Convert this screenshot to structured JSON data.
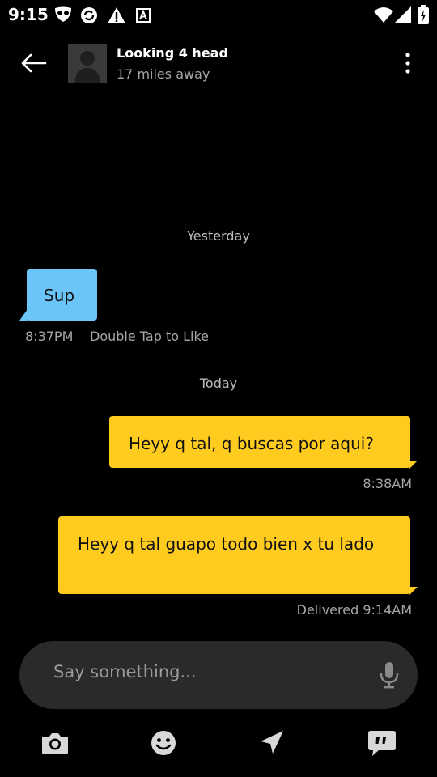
{
  "status_bar": {
    "time": "9:15",
    "icons": [
      "grindr-mask-icon",
      "sync-icon",
      "warning-icon",
      "font-a-icon",
      "wifi-icon",
      "signal-icon",
      "battery-icon"
    ]
  },
  "header": {
    "back_icon": "arrow-left-icon",
    "profile_name": "Looking 4 head",
    "distance": "17 miles away",
    "menu_icon": "more-vert-icon"
  },
  "conversation": {
    "sections": [
      {
        "day": "Yesterday",
        "messages": [
          {
            "direction": "incoming",
            "text": "Sup",
            "time": "8:37PM",
            "hint": "Double Tap to Like"
          }
        ]
      },
      {
        "day": "Today",
        "messages": [
          {
            "direction": "outgoing",
            "text": "Heyy q tal, q buscas por aqui?",
            "status": "8:38AM"
          },
          {
            "direction": "outgoing",
            "text": "Heyy q tal guapo todo bien x tu lado",
            "status": "Delivered 9:14AM"
          }
        ]
      }
    ]
  },
  "composer": {
    "placeholder": "Say something...",
    "mic_icon": "microphone-icon"
  },
  "toolbar": {
    "items": [
      "camera-icon",
      "emoji-icon",
      "send-location-icon",
      "saved-phrases-icon"
    ]
  },
  "colors": {
    "background": "#000000",
    "incoming_bubble": "#6cc5f8",
    "outgoing_bubble": "#ffcb1f",
    "composer_bg": "#2a2a2a",
    "muted_text": "#a6a6a6"
  }
}
